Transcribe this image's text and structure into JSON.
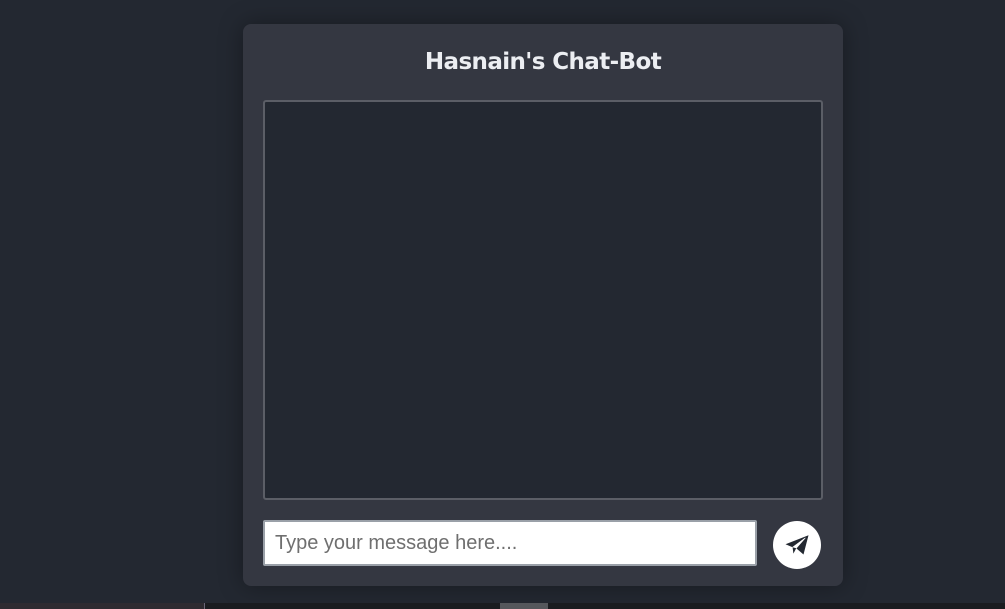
{
  "app": {
    "title": "Hasnain's Chat-Bot"
  },
  "composer": {
    "placeholder": "Type your message here....",
    "value": ""
  },
  "send": {
    "icon": "paper-plane-icon"
  },
  "colors": {
    "page_background": "#232831",
    "card_background": "#343741",
    "title_text": "#eceef2",
    "message_area_background": "#232831",
    "message_area_border": "#5b5e66",
    "send_button_background": "#ffffff",
    "send_icon": "#232831"
  }
}
